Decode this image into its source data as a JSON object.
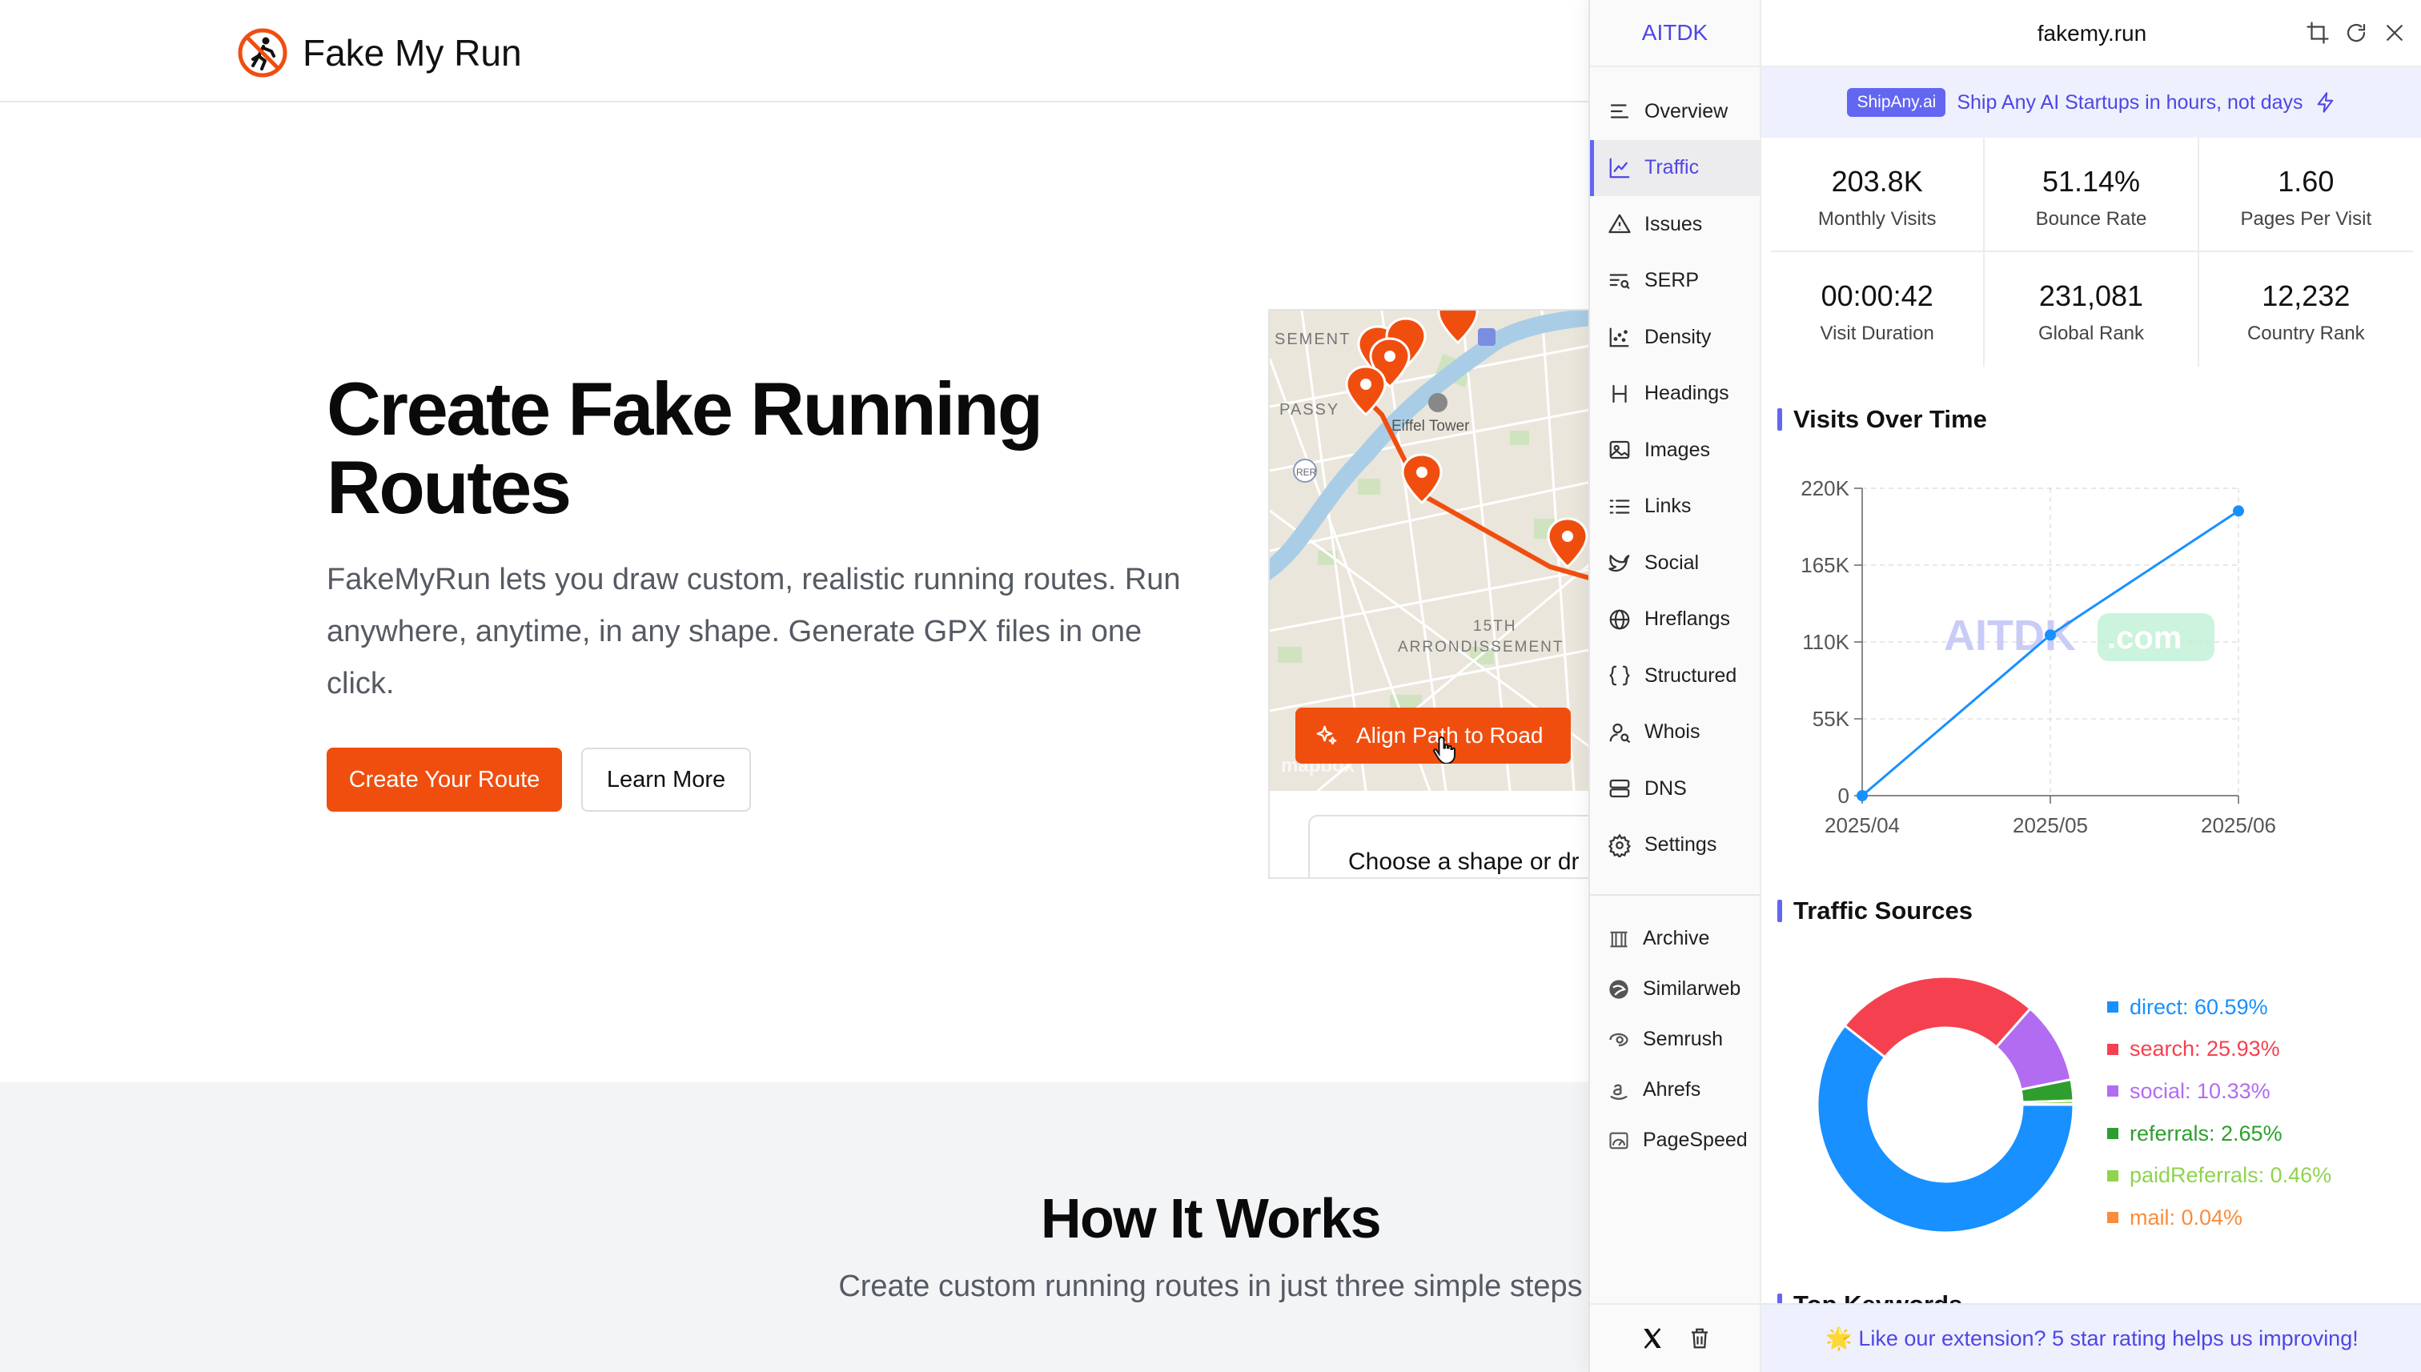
{
  "site": {
    "brand": "Fake My Run",
    "hero_title": "Create Fake Running Routes",
    "hero_description": "FakeMyRun lets you draw custom, realistic running routes. Run anywhere, anytime, in any shape. Generate GPX files in one click.",
    "primary_button": "Create Your Route",
    "secondary_button": "Learn More",
    "map_labels": {
      "semen": "SEMENT",
      "passy": "PASSY",
      "eiffel": "Eiffel Tower",
      "arr_line1": "15TH",
      "arr_line2": "ARRONDISSEMENT",
      "rer": "RER",
      "mapbox": "mapbox"
    },
    "align_button": "Align Path to Road",
    "choose_text": "Choose a shape or dr",
    "how_title": "How It Works",
    "how_subtitle": "Create custom running routes in just three simple steps"
  },
  "extension": {
    "brand": "AITDK",
    "domain": "fakemy.run",
    "nav_items": [
      {
        "label": "Overview",
        "icon": "overview-icon"
      },
      {
        "label": "Traffic",
        "icon": "traffic-icon",
        "active": true
      },
      {
        "label": "Issues",
        "icon": "warning-icon"
      },
      {
        "label": "SERP",
        "icon": "serp-icon"
      },
      {
        "label": "Density",
        "icon": "density-icon"
      },
      {
        "label": "Headings",
        "icon": "heading-icon"
      },
      {
        "label": "Images",
        "icon": "image-icon"
      },
      {
        "label": "Links",
        "icon": "links-icon"
      },
      {
        "label": "Social",
        "icon": "social-icon"
      },
      {
        "label": "Hreflangs",
        "icon": "globe-icon"
      },
      {
        "label": "Structured",
        "icon": "braces-icon"
      },
      {
        "label": "Whois",
        "icon": "user-search-icon"
      },
      {
        "label": "DNS",
        "icon": "server-icon"
      },
      {
        "label": "Settings",
        "icon": "gear-icon"
      }
    ],
    "external_items": [
      {
        "label": "Archive",
        "icon": "archive-icon"
      },
      {
        "label": "Similarweb",
        "icon": "similarweb-icon"
      },
      {
        "label": "Semrush",
        "icon": "semrush-icon"
      },
      {
        "label": "Ahrefs",
        "icon": "ahrefs-icon"
      },
      {
        "label": "PageSpeed",
        "icon": "pagespeed-icon"
      }
    ],
    "promo": {
      "badge": "ShipAny.ai",
      "text": "Ship Any AI Startups in hours, not days"
    },
    "stats": [
      {
        "value": "203.8K",
        "label": "Monthly Visits"
      },
      {
        "value": "51.14%",
        "label": "Bounce Rate"
      },
      {
        "value": "1.60",
        "label": "Pages Per Visit"
      },
      {
        "value": "00:00:42",
        "label": "Visit Duration"
      },
      {
        "value": "231,081",
        "label": "Global Rank"
      },
      {
        "value": "12,232",
        "label": "Country Rank"
      }
    ],
    "visits_title": "Visits Over Time",
    "watermark": "AITDK",
    "watermark_suffix": ".com",
    "sources_title": "Traffic Sources",
    "next_section_title": "Top Keywords",
    "footer_text": "🌟 Like our extension? 5 star rating helps us improving!"
  },
  "chart_data": [
    {
      "type": "line",
      "title": "Visits Over Time",
      "x": [
        "2025/04",
        "2025/05",
        "2025/06"
      ],
      "values": [
        0,
        115000,
        203800
      ],
      "yticks": [
        0,
        55000,
        110000,
        165000,
        220000
      ],
      "ytick_labels": [
        "0",
        "55K",
        "110K",
        "165K",
        "220K"
      ],
      "ylim": [
        0,
        220000
      ],
      "color": "#1890ff",
      "grid": true
    },
    {
      "type": "pie",
      "title": "Traffic Sources",
      "donut": true,
      "categories": [
        "direct",
        "search",
        "social",
        "referrals",
        "paidReferrals",
        "mail"
      ],
      "values": [
        60.59,
        25.93,
        10.33,
        2.65,
        0.46,
        0.04
      ],
      "labels": [
        "direct: 60.59%",
        "search: 25.93%",
        "social: 10.33%",
        "referrals: 2.65%",
        "paidReferrals: 0.46%",
        "mail: 0.04%"
      ],
      "colors": [
        "#1890ff",
        "#f5414f",
        "#b26cf2",
        "#2e9e2e",
        "#8ed44d",
        "#fa8c3c"
      ],
      "legend": "right"
    }
  ]
}
